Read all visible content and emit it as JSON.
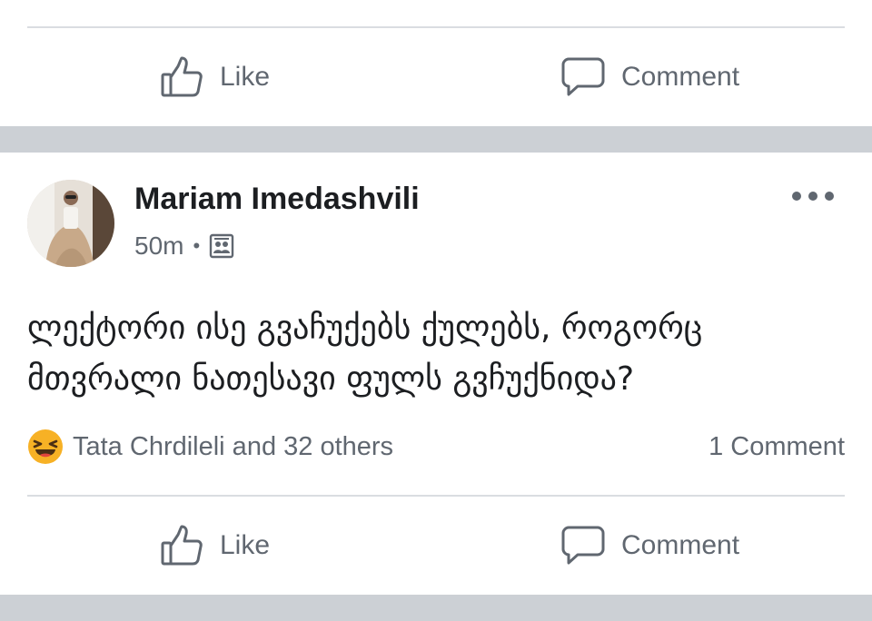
{
  "previous_post": {
    "actions": {
      "like_label": "Like",
      "comment_label": "Comment"
    }
  },
  "post": {
    "author": "Mariam Imedashvili",
    "time": "50m",
    "privacy_icon": "friends-icon",
    "text_line1": "ლექტორი ისე გვაჩუქებს ქულებს, როგორც",
    "text_line2": "მთვრალი ნათესავი ფულს გვჩუქნიდა?",
    "reactions": {
      "emoji": "laughing-emoji-icon",
      "summary": "Tata Chrdileli and 32 others"
    },
    "comments_count": "1 Comment",
    "actions": {
      "like_label": "Like",
      "comment_label": "Comment"
    }
  },
  "colors": {
    "text_primary": "#1c1e21",
    "text_secondary": "#606770",
    "divider": "#dadde1",
    "feed_gap": "#ccd0d5",
    "haha_yellow": "#f7b125"
  }
}
